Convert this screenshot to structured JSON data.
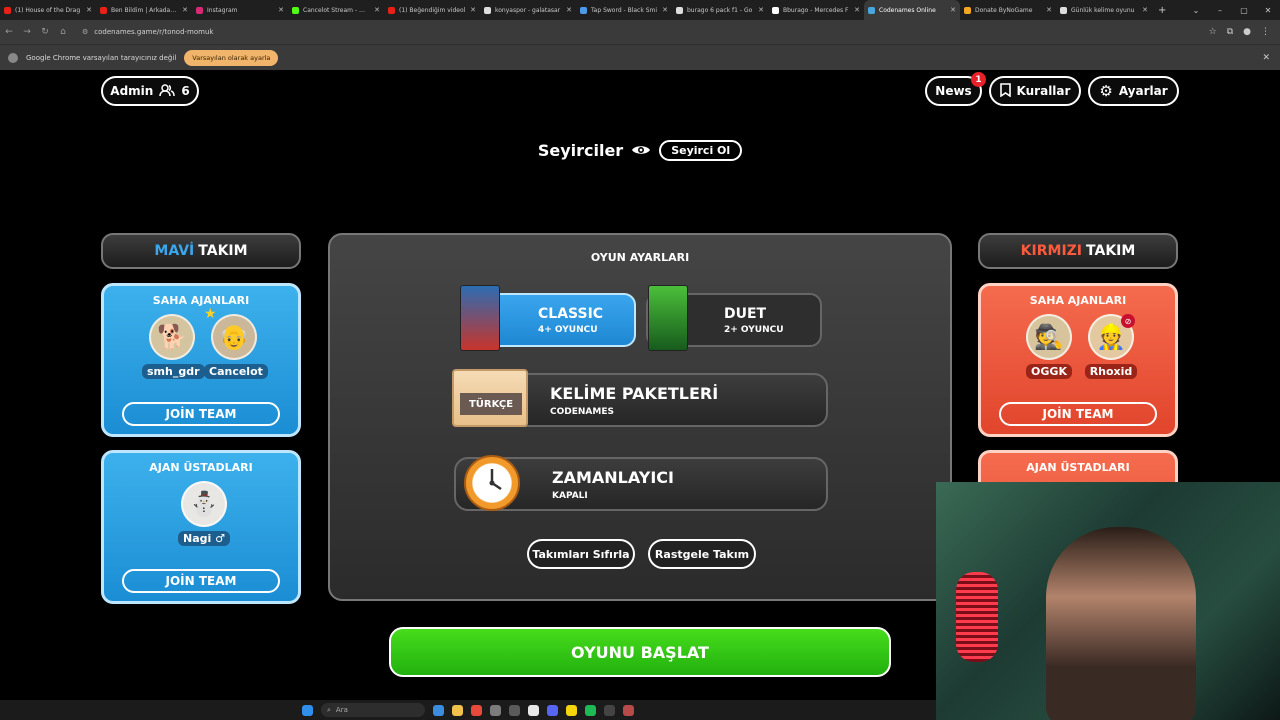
{
  "browser": {
    "tabs": [
      {
        "title": "(1) House of the Drag",
        "color": "#e62117"
      },
      {
        "title": "Ben Bildim | Arkadaşla",
        "color": "#e62117"
      },
      {
        "title": "Instagram",
        "color": "#d62976"
      },
      {
        "title": "Cancelot Stream - Wat",
        "color": "#53fc18"
      },
      {
        "title": "(1) Beğendiğim videol",
        "color": "#e62117"
      },
      {
        "title": "konyaspor - galatasar",
        "color": "#dddddd"
      },
      {
        "title": "Tap Sword - Black Smi",
        "color": "#4c9be8"
      },
      {
        "title": "burago 6 pack f1 - Go",
        "color": "#dddddd"
      },
      {
        "title": "Bburago - Mercedes F",
        "color": "#ffffff"
      },
      {
        "title": "Codenames Online",
        "color": "#4aa6e0",
        "active": true
      },
      {
        "title": "Donate ByNoGame",
        "color": "#f5a623"
      },
      {
        "title": "Günlük kelime oyunu",
        "color": "#dddddd"
      }
    ],
    "url": "codenames.game/r/tonod-momuk",
    "infobar_text": "Google Chrome varsayılan tarayıcınız değil",
    "infobar_button": "Varsayılan olarak ayarla"
  },
  "header": {
    "admin_label": "Admin",
    "player_count": "6",
    "news_label": "News",
    "news_badge": "1",
    "rules_label": "Kurallar",
    "settings_label": "Ayarlar"
  },
  "spectators": {
    "title": "Seyirciler",
    "button": "Seyirci Ol"
  },
  "blue_team": {
    "name_colored": "MAVİ",
    "name_rest": "TAKIM",
    "color": "#3aa6ee",
    "operatives_title": "SAHA AJANLARI",
    "operatives": [
      "smh_gdr",
      "Cancelot"
    ],
    "spymasters_title": "AJAN ÜSTADLARI",
    "spymasters": [
      "Nagi ♂"
    ],
    "join_label": "JOİN TEAM",
    "join_label_2": "JOİN TEAM"
  },
  "red_team": {
    "name_colored": "KIRMIZI",
    "name_rest": "TAKIM",
    "color": "#ff5a3c",
    "operatives_title": "SAHA AJANLARI",
    "operatives": [
      "OGGK",
      "Rhoxid"
    ],
    "spymasters_title": "AJAN ÜSTADLARI",
    "join_label": "JOİN TEAM"
  },
  "game_settings": {
    "title": "OYUN AYARLARI",
    "modes": [
      {
        "name": "CLASSIC",
        "sub": "4+ OYUNCU",
        "selected": true
      },
      {
        "name": "DUET",
        "sub": "2+ OYUNCU",
        "selected": false
      }
    ],
    "word_pack": {
      "title": "KELİME PAKETLERİ",
      "sub": "CODENAMES",
      "tag": "TÜRKÇE"
    },
    "timer": {
      "title": "ZAMANLAYICI",
      "sub": "KAPALI"
    },
    "reset_teams": "Takımları Sıfırla",
    "random_team": "Rastgele Takım",
    "start_button": "OYUNU BAŞLAT"
  },
  "taskbar": {
    "search_placeholder": "Ara"
  }
}
